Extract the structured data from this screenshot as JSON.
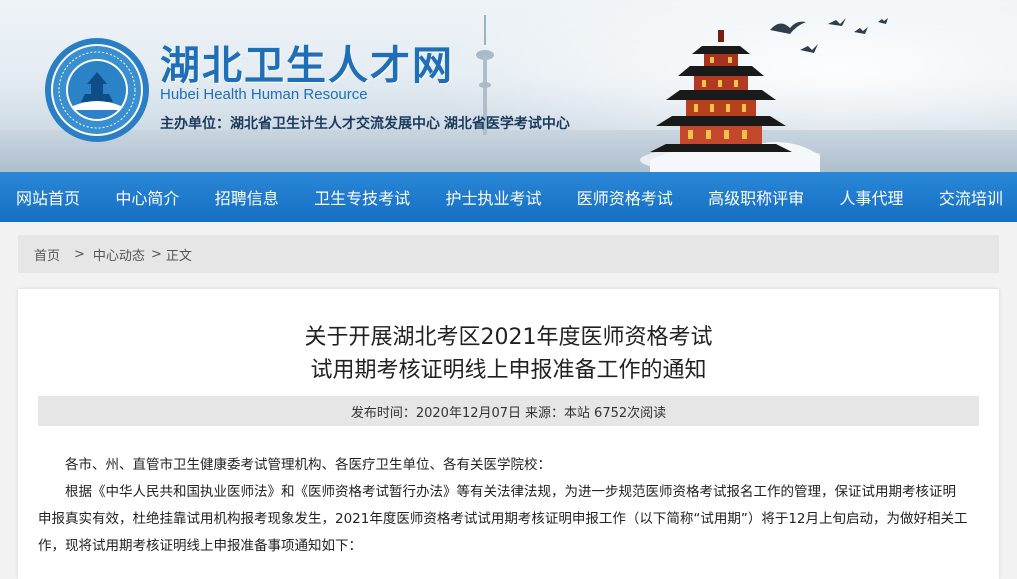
{
  "header": {
    "title": "湖北卫生人才网",
    "subtitle": "Hubei Health Human Resource",
    "host": "主办单位：湖北省卫生计生人才交流发展中心   湖北省医学考试中心",
    "brand_color": "#1f6fb8"
  },
  "nav": {
    "items": [
      {
        "label": "网站首页"
      },
      {
        "label": "中心简介"
      },
      {
        "label": "招聘信息"
      },
      {
        "label": "卫生专技考试"
      },
      {
        "label": "护士执业考试"
      },
      {
        "label": "医师资格考试"
      },
      {
        "label": "高级职称评审"
      },
      {
        "label": "人事代理"
      },
      {
        "label": "交流培训"
      }
    ],
    "bg_color": "#1a74c8"
  },
  "breadcrumb": {
    "home": "首页",
    "sep1": ">",
    "section": "中心动态",
    "sep2": ">",
    "current": "正文"
  },
  "article": {
    "title_line1": "关于开展湖北考区2021年度医师资格考试",
    "title_line2": "试用期考核证明线上申报准备工作的通知",
    "meta": {
      "date_label": "发布时间：2020年12月07日",
      "source_label": "来源：本站",
      "reads_label": "6752次阅读"
    },
    "paragraphs": [
      "各市、州、直管市卫生健康委考试管理机构、各医疗卫生单位、各有关医学院校：",
      "根据《中华人民共和国执业医师法》和《医师资格考试暂行办法》等有关法律法规，为进一步规范医师资格考试报名工作的管理，保证试用期考核证明申报真实有效，杜绝挂靠试用机构报考现象发生，2021年度医师资格考试试用期考核证明申报工作（以下简称“试用期”）将于12月上旬启动，为做好相关工作，现将试用期考核证明线上申报准备事项通知如下："
    ]
  }
}
